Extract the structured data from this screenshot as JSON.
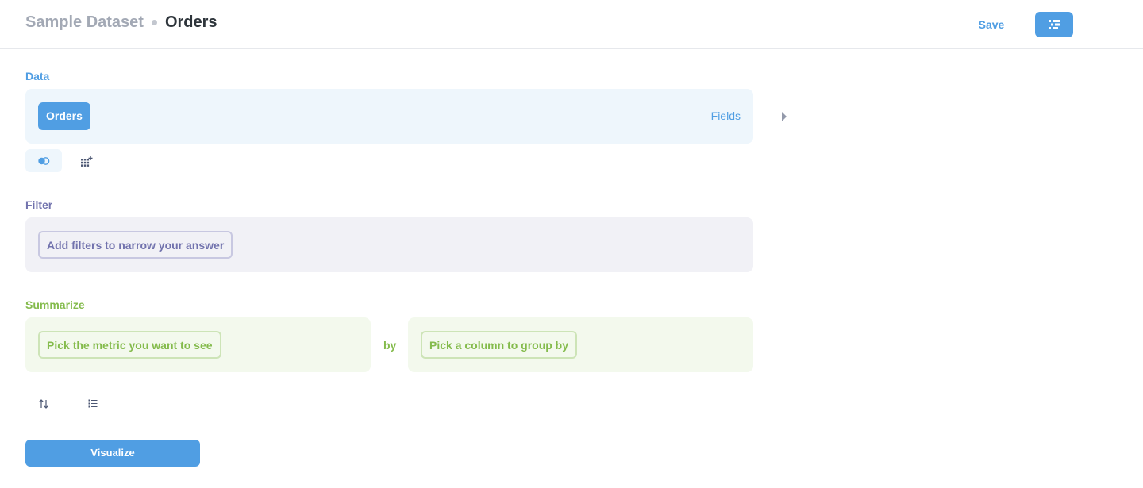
{
  "header": {
    "database": "Sample Dataset",
    "table": "Orders",
    "save_label": "Save",
    "notebook_icon": "notebook-icon"
  },
  "data_step": {
    "label": "Data",
    "table_name": "Orders",
    "fields_label": "Fields",
    "actions": [
      "join-icon",
      "add-column-icon"
    ]
  },
  "filter_step": {
    "label": "Filter",
    "placeholder": "Add filters to narrow your answer"
  },
  "summarize_step": {
    "label": "Summarize",
    "metric_placeholder": "Pick the metric you want to see",
    "by_label": "by",
    "group_placeholder": "Pick a column to group by",
    "actions": [
      "sort-icon",
      "limit-icon"
    ]
  },
  "visualize_label": "Visualize",
  "colors": {
    "brand": "#509ee3",
    "filter": "#7172ad",
    "summarize": "#84bb4c",
    "text_dark": "#2e353b",
    "text_muted": "#a3a9b5"
  }
}
